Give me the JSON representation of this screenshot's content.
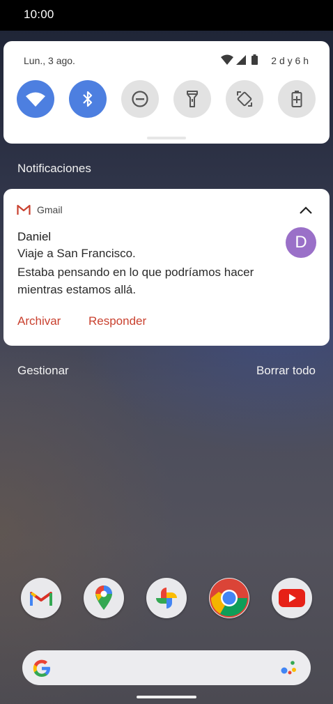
{
  "status_bar": {
    "time": "10:00"
  },
  "quick_settings": {
    "date": "Lun., 3 ago.",
    "battery_remaining": "2 d y 6 h",
    "tiles": [
      {
        "name": "wifi",
        "state": "on"
      },
      {
        "name": "bluetooth",
        "state": "on"
      },
      {
        "name": "do-not-disturb",
        "state": "off"
      },
      {
        "name": "flashlight",
        "state": "off"
      },
      {
        "name": "auto-rotate",
        "state": "off"
      },
      {
        "name": "battery-saver",
        "state": "off"
      }
    ]
  },
  "notifications": {
    "section_title": "Notificaciones",
    "items": [
      {
        "app": "Gmail",
        "sender": "Daniel",
        "subject": "Viaje a San Francisco.",
        "body": "Estaba pensando en lo que podríamos hacer mientras estamos allá.",
        "avatar_letter": "D",
        "avatar_color": "#9a70c8",
        "actions": {
          "archive": "Archivar",
          "reply": "Responder"
        }
      }
    ],
    "manage_label": "Gestionar",
    "clear_all_label": "Borrar todo"
  },
  "colors": {
    "accent_on": "#4d7fe0",
    "action_text": "#c9412f"
  },
  "dock": {
    "apps": [
      "Gmail",
      "Maps",
      "Photos",
      "Chrome",
      "YouTube"
    ]
  }
}
